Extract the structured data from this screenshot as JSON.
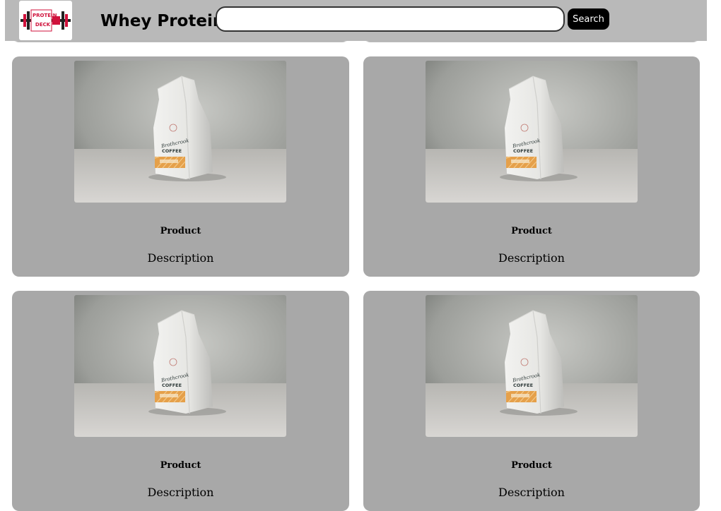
{
  "header": {
    "logo_text_1": "PROTEIN",
    "logo_text_2": "DECK",
    "title": "Whey Protein",
    "search_placeholder": "",
    "search_value": "",
    "search_button_label": "Search"
  },
  "products": [
    {
      "name": "Product",
      "description": "Description",
      "bag_brand": "Brothcrook",
      "bag_product": "COFFEE"
    },
    {
      "name": "Product",
      "description": "Description",
      "bag_brand": "Brothcrook",
      "bag_product": "COFFEE"
    },
    {
      "name": "Product",
      "description": "Description",
      "bag_brand": "Brothcrook",
      "bag_product": "COFFEE"
    },
    {
      "name": "Product",
      "description": "Description",
      "bag_brand": "Brothcrook",
      "bag_product": "COFFEE"
    }
  ],
  "colors": {
    "header_bg": "#b9b9b9",
    "card_bg": "#a8a8a8",
    "logo_red": "#d0113b",
    "button_bg": "#000000"
  }
}
